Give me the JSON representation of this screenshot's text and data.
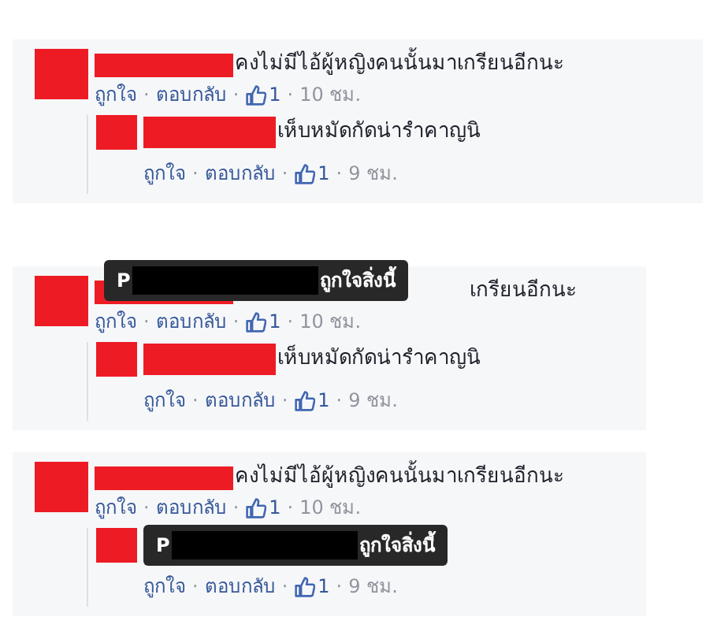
{
  "panels": [
    {
      "comment": {
        "text": "คงไม่มีไอ้ผู้หญิงคนนั้นมาเกรียนอีกนะ",
        "like_label": "ถูกใจ",
        "reply_label": "ตอบกลับ",
        "like_count": "1",
        "time": "10 ชม.",
        "separator": "·"
      },
      "reply": {
        "text": "เห็บหมัดกัดน่ารำคาญนิ",
        "like_label": "ถูกใจ",
        "reply_label": "ตอบกลับ",
        "like_count": "1",
        "time": "9 ชม.",
        "separator": "·"
      }
    },
    {
      "comment": {
        "text": "เกรียนอีกนะ",
        "like_label": "ถูกใจ",
        "reply_label": "ตอบกลับ",
        "like_count": "1",
        "time": "10 ชม.",
        "separator": "·",
        "tooltip": {
          "initial": "P",
          "suffix": "ถูกใจสิ่งนี้"
        }
      },
      "reply": {
        "text": "เห็บหมัดกัดน่ารำคาญนิ",
        "like_label": "ถูกใจ",
        "reply_label": "ตอบกลับ",
        "like_count": "1",
        "time": "9 ชม.",
        "separator": "·"
      }
    },
    {
      "comment": {
        "text": "คงไม่มีไอ้ผู้หญิงคนนั้นมาเกรียนอีกนะ",
        "like_label": "ถูกใจ",
        "reply_label": "ตอบกลับ",
        "like_count": "1",
        "time": "10 ชม.",
        "separator": "·"
      },
      "reply": {
        "like_label": "ถูกใจ",
        "reply_label": "ตอบกลับ",
        "like_count": "1",
        "time": "9 ชม.",
        "separator": "·",
        "tooltip": {
          "initial": "P",
          "suffix": "ถูกใจสิ่งนี้"
        }
      }
    }
  ]
}
